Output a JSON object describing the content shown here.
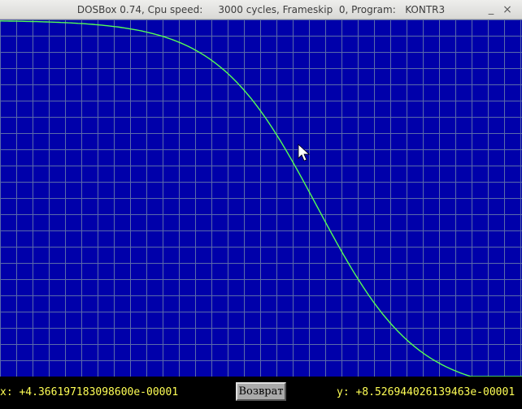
{
  "window": {
    "title": "DOSBox 0.74, Cpu speed:     3000 cycles, Frameskip  0, Program:   KONTR3",
    "minimize_glyph": "_",
    "close_glyph": "×"
  },
  "plot": {
    "background": "#0000aa",
    "grid_color": "#5a6aaa",
    "curve_color": "#55ff55",
    "curve_shape": "descending sigmoid, starts flat at top-left, steepest near center, ends near bottom-right",
    "cursor": "arrow-pointer-icon"
  },
  "status": {
    "x_readout": "x: +4.366197183098600e-00001",
    "y_readout": "y: +8.526944026139463e-00001",
    "return_button": "Возврат"
  },
  "colors": {
    "readout_text": "#ffff55",
    "button_face": "#aaaaaa"
  }
}
